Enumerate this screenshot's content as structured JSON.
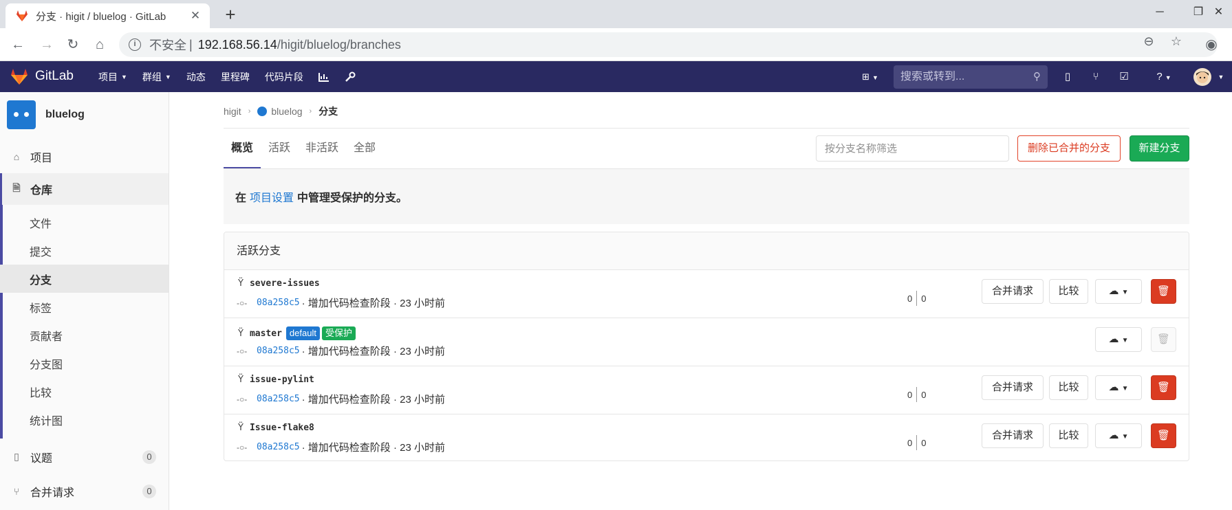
{
  "browser": {
    "tab_title": "分支 · higit / bluelog · GitLab",
    "url_insecure": "不安全",
    "url_separator": "|",
    "url_host": "192.168.56.14",
    "url_path": "/higit/bluelog/branches"
  },
  "navbar": {
    "brand": "GitLab",
    "menu": [
      "项目",
      "群组",
      "动态",
      "里程碑",
      "代码片段"
    ],
    "search_placeholder": "搜索或转到..."
  },
  "sidebar": {
    "project_name": "bluelog",
    "items": {
      "project": "项目",
      "repository": "仓库",
      "issues": "议题",
      "issues_count": "0",
      "merge_requests": "合并请求",
      "merge_requests_count": "0"
    },
    "repo_subitems": [
      "文件",
      "提交",
      "分支",
      "标签",
      "贡献者",
      "分支图",
      "比较",
      "统计图"
    ]
  },
  "breadcrumb": {
    "group": "higit",
    "project": "bluelog",
    "current": "分支"
  },
  "tabs": [
    "概览",
    "活跃",
    "非活跃",
    "全部"
  ],
  "toolbar": {
    "filter_placeholder": "按分支名称筛选",
    "delete_merged": "删除已合并的分支",
    "new_branch": "新建分支"
  },
  "notice": {
    "prefix": "在",
    "link": "项目设置",
    "suffix": "中管理受保护的分支。"
  },
  "panel": {
    "title": "活跃分支",
    "merge_request_label": "合并请求",
    "compare_label": "比较",
    "branches": [
      {
        "name": "severe-issues",
        "sha": "08a258c5",
        "message": "· 增加代码检查阶段 · 23 小时前",
        "behind": "0",
        "ahead": "0"
      },
      {
        "name": "master",
        "default_badge": "default",
        "protected_badge": "受保护",
        "sha": "08a258c5",
        "message": "· 增加代码检查阶段 · 23 小时前"
      },
      {
        "name": "issue-pylint",
        "sha": "08a258c5",
        "message": "· 增加代码检查阶段 · 23 小时前",
        "behind": "0",
        "ahead": "0"
      },
      {
        "name": "Issue-flake8",
        "sha": "08a258c5",
        "message": "· 增加代码检查阶段 · 23 小时前",
        "behind": "0",
        "ahead": "0"
      }
    ]
  },
  "colors": {
    "navbar": "#292961",
    "accent": "#4b4ba3",
    "link": "#1f78d1",
    "success": "#1aaa55",
    "danger": "#db3b21"
  }
}
